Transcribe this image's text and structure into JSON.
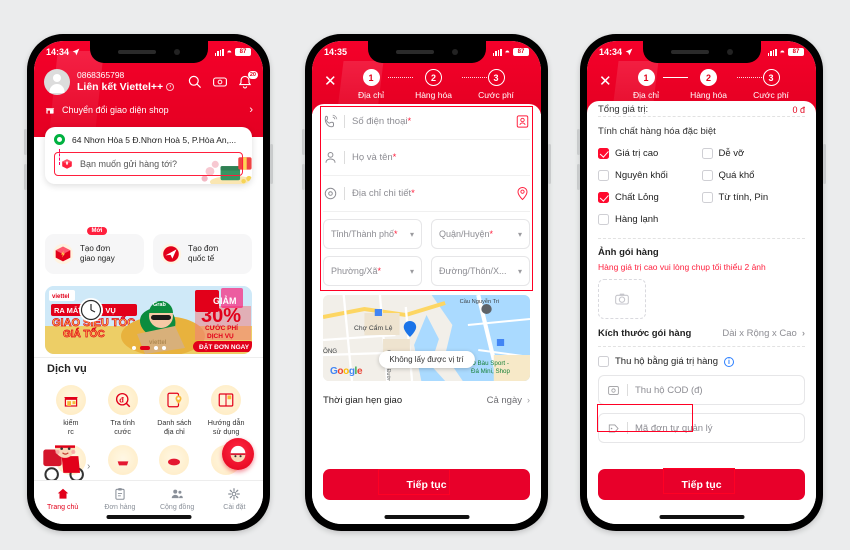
{
  "background_color": "#ebeced",
  "brand": {
    "red": "#e2001a",
    "bright_red": "#ff0024",
    "green": "#00b140"
  },
  "phone1": {
    "status": {
      "time": "14:34",
      "battery": "87"
    },
    "account": {
      "phone_number": "0868365798",
      "name": "Liên kết Viettel++",
      "info_char": "›"
    },
    "icons": {
      "search": "search-icon",
      "voucher": "voucher-icon",
      "notification": "bell-icon",
      "notification_badge": "20"
    },
    "shop_switch": {
      "label": "Chuyển đổi giao diện shop",
      "chevron": "›"
    },
    "address_card": {
      "pickup": "64 Nhơn Hòa 5 Đ.Nhơn Hoà 5, P.Hòa An,...",
      "destination_placeholder": "Bạn muốn gửi hàng tới?"
    },
    "quick_actions": [
      {
        "title_line1": "Tạo đơn",
        "title_line2": "giao ngay",
        "badge": "Mới"
      },
      {
        "title_line1": "Tạo đơn",
        "title_line2": "quốc tế",
        "badge": ""
      }
    ],
    "banner": {
      "logo": "viettel",
      "line1": "RA MẮT DỊCH VỤ",
      "line2": "GIAO SIÊU TỐC",
      "line3": "GIÁ TỐC",
      "discount_label": "GIẢM",
      "discount_value": "30%",
      "discount_sub1": "CƯỚC PHÍ",
      "discount_sub2": "DỊCH VỤ",
      "cta": "ĐẶT ĐƠN NGAY"
    },
    "services_title": "Dịch vụ",
    "services": [
      {
        "label_line1": "kiếm",
        "label_line2": "rc",
        "icon": "store-icon"
      },
      {
        "label_line1": "Tra tính",
        "label_line2": "cước",
        "icon": "price-search-icon"
      },
      {
        "label_line1": "Danh sách",
        "label_line2": "địa chỉ",
        "icon": "address-list-icon"
      },
      {
        "label_line1": "Hướng dẫn",
        "label_line2": "sử dụng",
        "icon": "guide-book-icon"
      }
    ],
    "tabs": [
      {
        "label": "Trang chủ",
        "icon": "home-icon",
        "active": true
      },
      {
        "label": "Đơn hàng",
        "icon": "orders-icon",
        "active": false
      },
      {
        "label": "Cộng đồng",
        "icon": "community-icon",
        "active": false
      },
      {
        "label": "Cài đặt",
        "icon": "settings-icon",
        "active": false
      }
    ]
  },
  "phone2": {
    "status": {
      "time": "14:35",
      "battery": "87"
    },
    "close_label": "✕",
    "steps": [
      {
        "num": "1",
        "label": "Địa chỉ",
        "state": "done"
      },
      {
        "num": "2",
        "label": "Hàng hóa",
        "state": "todo"
      },
      {
        "num": "3",
        "label": "Cước phí",
        "state": "todo"
      }
    ],
    "fields": [
      {
        "placeholder": "Số điện thoại",
        "required": "*",
        "icon": "phone-call-icon",
        "action_icon": "contacts-icon"
      },
      {
        "placeholder": "Họ và tên",
        "required": "*",
        "icon": "user-icon",
        "action_icon": ""
      },
      {
        "placeholder": "Địa chỉ chi tiết",
        "required": "*",
        "icon": "location-target-icon",
        "action_icon": "map-pin-icon"
      }
    ],
    "selects": [
      {
        "placeholder": "Tỉnh/Thành phố",
        "required": "*"
      },
      {
        "placeholder": "Quận/Huyện",
        "required": "*"
      },
      {
        "placeholder": "Phường/Xã",
        "required": "*"
      },
      {
        "placeholder": "Đường/Thôn/X...",
        "required": ""
      }
    ],
    "map": {
      "tooltip": "Không lấy được vị trí",
      "labels": [
        "Chợ Cẩm Lệ",
        "ÔNG",
        "Ô Bàu Sport -",
        "Đá Mini, Shop",
        "Cầu Nguyễn Tri"
      ],
      "street_label": "Ông Ích Đường",
      "watermark": "Google"
    },
    "delivery_time": {
      "label": "Thời gian hẹn giao",
      "value": "Cả ngày",
      "chevron": "›"
    },
    "cta": "Tiếp tục"
  },
  "phone3": {
    "status": {
      "time": "14:34",
      "battery": "87"
    },
    "close_label": "✕",
    "steps": [
      {
        "num": "1",
        "label": "Địa chỉ",
        "state": "done"
      },
      {
        "num": "2",
        "label": "Hàng hóa",
        "state": "done"
      },
      {
        "num": "3",
        "label": "Cước phí",
        "state": "todo"
      }
    ],
    "total": {
      "label": "Tổng giá trị:",
      "value": "0 đ"
    },
    "special_title": "Tính chất hàng hóa đặc biệt",
    "checkboxes": [
      {
        "label": "Giá trị cao",
        "checked": true
      },
      {
        "label": "Dễ vỡ",
        "checked": false
      },
      {
        "label": "Nguyên khối",
        "checked": false
      },
      {
        "label": "Quá khổ",
        "checked": false
      },
      {
        "label": "Chất Lỏng",
        "checked": true
      },
      {
        "label": "Từ tính, Pin",
        "checked": false
      },
      {
        "label": "Hàng lạnh",
        "checked": false
      },
      {
        "label": "",
        "checked": false
      }
    ],
    "photo_title": "Ảnh gói hàng",
    "photo_warning": "Hàng giá trị cao vui lòng chụp tối thiểu 2 ảnh",
    "photo_icon": "camera-icon",
    "size_row": {
      "label": "Kích thước gói hàng",
      "value": "Dài x Rộng x Cao",
      "chevron": "›"
    },
    "cod_checkbox": {
      "label": "Thu hộ bằng giá trị hàng",
      "checked": false,
      "info": "i"
    },
    "cod_input": {
      "placeholder": "Thu hộ COD (đ)",
      "icon": "cod-coin-icon"
    },
    "order_code_input": {
      "placeholder": "Mã đơn tự quản lý",
      "icon": "tag-icon"
    },
    "cta": "Tiếp tục"
  }
}
